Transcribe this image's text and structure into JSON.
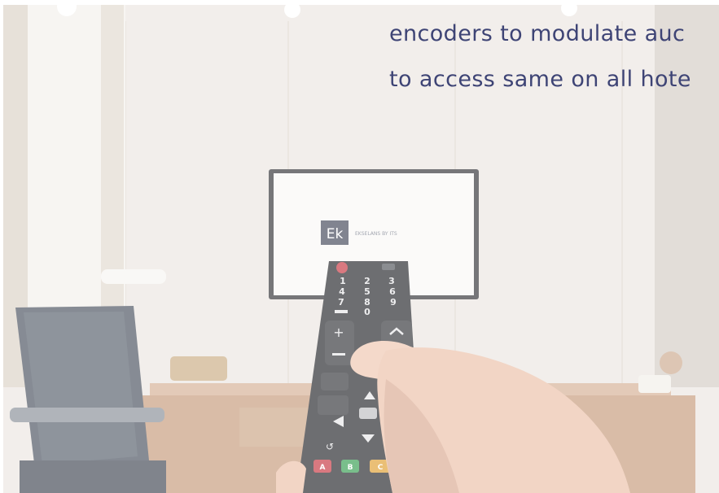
{
  "caption": {
    "line1": "encoders to modulate auc",
    "line2": "to access same on all hote"
  },
  "tv": {
    "logo_letters": "Ek",
    "brand_text": "EKSELANS BY ITS"
  },
  "remote": {
    "numbers": [
      "1",
      "2",
      "3",
      "4",
      "5",
      "6",
      "7",
      "8",
      "9",
      "0"
    ],
    "color_buttons": [
      "A",
      "B",
      "C"
    ],
    "color_values": {
      "A": "#c9404a",
      "B": "#3fa35a",
      "C": "#e1a43c"
    }
  },
  "colors": {
    "caption_text": "#3e4475",
    "wall": "#ece7e2",
    "desk": "#cfa587"
  }
}
